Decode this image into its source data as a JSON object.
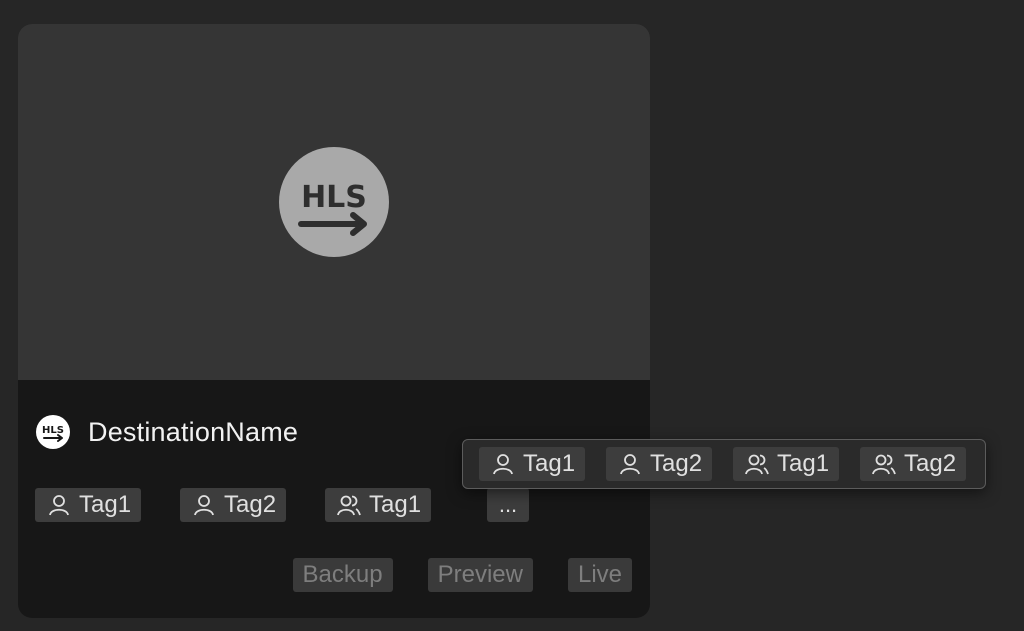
{
  "card": {
    "thumbnail_logo_text": "HLS",
    "small_logo_text": "HLS",
    "destination_name": "DestinationName",
    "tags": [
      {
        "icon": "user-icon",
        "label": "Tag1"
      },
      {
        "icon": "user-icon",
        "label": "Tag2"
      },
      {
        "icon": "users-icon",
        "label": "Tag1"
      }
    ],
    "more_label": "...",
    "actions": {
      "backup": "Backup",
      "preview": "Preview",
      "live": "Live"
    }
  },
  "popover": {
    "tags": [
      {
        "icon": "user-icon",
        "label": "Tag1"
      },
      {
        "icon": "user-icon",
        "label": "Tag2"
      },
      {
        "icon": "users-icon",
        "label": "Tag1"
      },
      {
        "icon": "users-icon",
        "label": "Tag2"
      }
    ]
  },
  "colors": {
    "background": "#262626",
    "card": "#171717",
    "thumbnail": "#353535",
    "logo_circle": "#a9a9a9",
    "tag_bg": "#3d3d3d",
    "action_text_disabled": "#7e7e7e"
  }
}
